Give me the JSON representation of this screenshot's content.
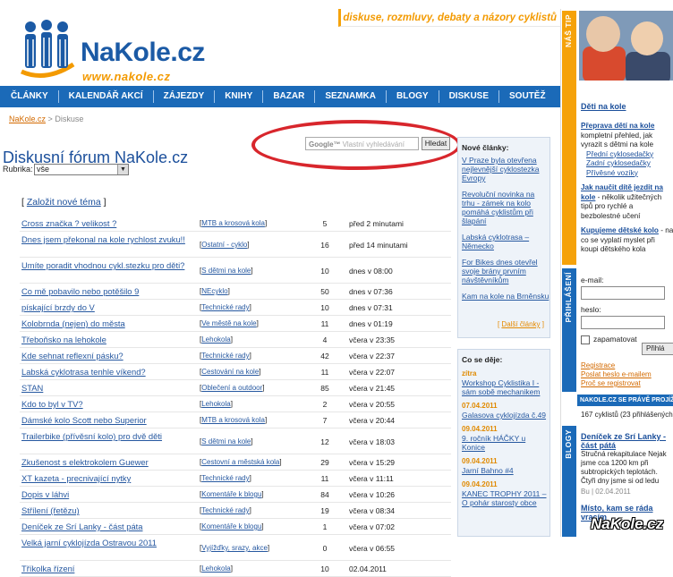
{
  "header": {
    "tagline": "diskuse, rozmluvy, debaty a názory cyklistů",
    "logo_text": "NaKole.cz",
    "logo_url": "www.nakole.cz"
  },
  "nav": [
    "ČLÁNKY",
    "KALENDÁŘ AKCÍ",
    "ZÁJEZDY",
    "KNIHY",
    "BAZAR",
    "SEZNAMKA",
    "BLOGY",
    "DISKUSE",
    "SOUTĚŽ"
  ],
  "breadcrumb": {
    "home": "NaKole.cz",
    "sep": ">",
    "current": "Diskuse"
  },
  "page_title": "Diskusní fórum NaKole.cz",
  "search": {
    "google": "Google™",
    "placeholder": "Vlastní vyhledávání",
    "button": "Hledat"
  },
  "rubrika": {
    "label": "Rubrika:",
    "selected": "vše"
  },
  "new_topic": "Založit nové téma",
  "topics": [
    {
      "title": "Cross značka ? velikost ?",
      "category": "MTB a krosová kola",
      "count": "5",
      "time": "před 2 minutami"
    },
    {
      "title": "Dnes jsem překonal na kole rychlost zvuku!!",
      "category": "Ostatní - cyklo",
      "count": "16",
      "time": "před 14 minutami"
    },
    {
      "title": "Umíte poradit vhodnou cykl.stezku pro děti?",
      "category": "S dětmi na kole",
      "count": "10",
      "time": "dnes v 08:00"
    },
    {
      "title": "Co mě pobavilo nebo potěšilo 9",
      "category": "NEcyklo",
      "count": "50",
      "time": "dnes v 07:36"
    },
    {
      "title": "pískající brzdy do V",
      "category": "Technické rady",
      "count": "10",
      "time": "dnes v 07:31"
    },
    {
      "title": "Kolobrnda (nejen) do města",
      "category": "Ve městě na kole",
      "count": "11",
      "time": "dnes v 01:19"
    },
    {
      "title": "Třeboňsko na lehokole",
      "category": "Lehokola",
      "count": "4",
      "time": "včera v 23:35"
    },
    {
      "title": "Kde sehnat reflexní pásku?",
      "category": "Technické rady",
      "count": "42",
      "time": "včera v 22:37"
    },
    {
      "title": "Labská cyklotrasa tenhle víkend?",
      "category": "Cestování na kole",
      "count": "11",
      "time": "včera v 22:07"
    },
    {
      "title": "STAN",
      "category": "Oblečení a outdoor",
      "count": "85",
      "time": "včera v 21:45"
    },
    {
      "title": "Kdo to byl v TV?",
      "category": "Lehokola",
      "count": "2",
      "time": "včera v 20:55"
    },
    {
      "title": "Dámské kolo Scott nebo Superior",
      "category": "MTB a krosová kola",
      "count": "7",
      "time": "včera v 20:44"
    },
    {
      "title": "Trailerbike (přívěsní kolo) pro dvě děti",
      "category": "S dětmi na kole",
      "count": "12",
      "time": "včera v 18:03"
    },
    {
      "title": "Zkušenost s elektrokolem Guewer",
      "category": "Cestovní a městská kola",
      "count": "29",
      "time": "včera v 15:29"
    },
    {
      "title": "XT kazeta - precnivající nytky",
      "category": "Technické rady",
      "count": "11",
      "time": "včera v 11:11"
    },
    {
      "title": "Dopis v láhvi",
      "category": "Komentáře k blogu",
      "count": "84",
      "time": "včera v 10:26"
    },
    {
      "title": "Střílení (řetězu)",
      "category": "Technické rady",
      "count": "19",
      "time": "včera v 08:34"
    },
    {
      "title": "Deníček ze Srí Lanky - část páta",
      "category": "Komentáře k blogu",
      "count": "1",
      "time": "včera v 07:02"
    },
    {
      "title": "Velká jarní cyklojízda Ostravou 2011",
      "category": "Vyjížďky, srazy, akce",
      "count": "0",
      "time": "včera v 06:55"
    },
    {
      "title": "Tříkolka řízení",
      "category": "Lehokola",
      "count": "10",
      "time": "02.04.2011"
    }
  ],
  "new_articles": {
    "heading": "Nové články:",
    "items": [
      "V Praze byla otevřena nejlevnější cyklostezka Evropy",
      "Revoluční novinka na trhu - zámek na kolo pomáhá cyklistům při šlapání",
      "Labská cyklotrasa – Německo",
      "For Bikes dnes otevřel svoje brány prvním návštěvníkům",
      "Kam na kole na Brněnsku"
    ],
    "more": "Další články"
  },
  "events": {
    "heading": "Co se děje:",
    "items": [
      {
        "date": "zítra",
        "title": "Workshop Cyklistika I - sám sobě mechanikem"
      },
      {
        "date": "07.04.2011",
        "title": "Galasova cyklojízda č.49"
      },
      {
        "date": "09.04.2011",
        "title": "9. ročník HÁČKY u Konice"
      },
      {
        "date": "09.04.2011",
        "title": "Jarní Bahno #4"
      },
      {
        "date": "09.04.2011",
        "title": "KANEC TROPHY 2011 – O pohár starosty obce"
      }
    ]
  },
  "sidebar": {
    "tip_label": "NÁŠ TIP",
    "tip_title": "Děti na kole",
    "tip_items": [
      {
        "head": "Přeprava dětí na kole",
        "text": "kompletní přehled, jak vyrazit s dětmi na kole",
        "subs": [
          "Přední cyklosedačky",
          "Zadní cyklosedačky",
          "Přívěsné vozíky"
        ]
      },
      {
        "head": "Jak naučit dítě jezdit na kole",
        "text": "- několik užitečných tipů pro rychlé a bezbolestné učení",
        "subs": []
      },
      {
        "head": "Kupujeme dětské kolo",
        "text": "- na co se vyplatí myslet při koupi dětského kola",
        "subs": []
      }
    ],
    "login_label": "PŘIHLÁŠENÍ",
    "email_label": "e-mail:",
    "password_label": "heslo:",
    "remember_label": "zapamatovat",
    "login_button": "Přihlá",
    "links": [
      "Registrace",
      "Poslat heslo e-mailem",
      "Proč se registrovat"
    ],
    "online_bar": "NAKOLE.CZ SE PRÁVĚ PROJÍŽDÍ",
    "online_text": "167 cyklistů (23 přihlášených)",
    "blogs_label": "BLOGY",
    "blogs": [
      {
        "title": "Deníček ze Srí Lanky - část pátá",
        "text": "Stručná rekapitulace Nejak jsme cca 1200 km při subtropických teplotách. Čtyři dny jsme si od ledu",
        "meta": "Bu | 02.04.2011"
      },
      {
        "title": "Místo, kam se ráda vracím",
        "text": "",
        "meta": ""
      }
    ],
    "watermark": "NaKole.cz"
  }
}
